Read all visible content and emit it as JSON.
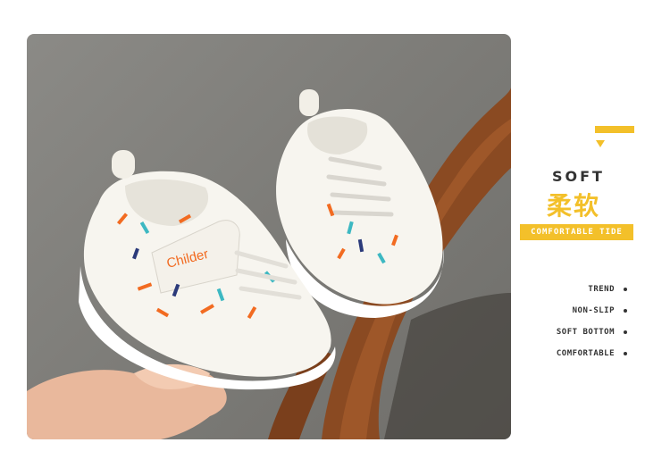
{
  "product": {
    "brand_text": "Childer",
    "heading_en": "SOFT",
    "heading_cn": "柔软",
    "tagline": "COMFORTABLE TIDE"
  },
  "features": [
    {
      "label": "TREND"
    },
    {
      "label": "NON-SLIP"
    },
    {
      "label": "SOFT BOTTOM"
    },
    {
      "label": "COMFORTABLE"
    }
  ],
  "colors": {
    "accent": "#f3c02a",
    "brand_text": "#f26b21",
    "text": "#333333"
  }
}
